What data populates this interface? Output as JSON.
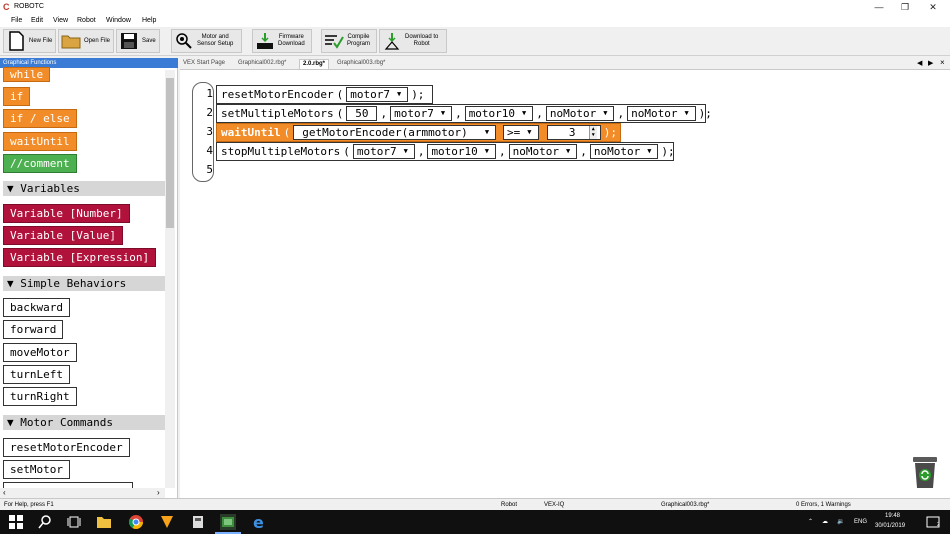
{
  "window": {
    "title": "ROBOTC"
  },
  "menu": [
    "File",
    "Edit",
    "View",
    "Robot",
    "Window",
    "Help"
  ],
  "toolbar": {
    "new_file": "New File",
    "open_file": "Open File",
    "save": "Save",
    "motor_sensor": "Motor and\nSensor Setup",
    "firmware": "Firmware\nDownload",
    "compile": "Compile\nProgram",
    "download": "Download to\nRobot"
  },
  "sidebar": {
    "header": "Graphical Functions",
    "flow_blocks": [
      "while",
      "if",
      "if / else",
      "waitUntil",
      "//comment"
    ],
    "sections": {
      "variables": "▼ Variables",
      "simple_behaviors": "▼ Simple Behaviors",
      "motor_commands": "▼ Motor Commands"
    },
    "variable_blocks": [
      "Variable [Number]",
      "Variable [Value]",
      "Variable [Expression]"
    ],
    "behavior_blocks": [
      "backward",
      "forward",
      "moveMotor",
      "turnLeft",
      "turnRight"
    ],
    "motor_blocks": [
      "resetMotorEncoder",
      "setMotor"
    ]
  },
  "tabs": [
    "VEX Start Page",
    "Graphical002.rbg*",
    "2.0.rbg*",
    "Graphical003.rbg*"
  ],
  "editor": {
    "line_numbers": [
      "1",
      "2",
      "3",
      "4",
      "5"
    ],
    "line1": {
      "fn": "resetMotorEncoder",
      "open": "(",
      "motor": "motor7",
      "close": ");"
    },
    "line2": {
      "fn": "setMultipleMotors",
      "open": "(",
      "speed": "50",
      "m1": "motor7",
      "m2": "motor10",
      "m3": "noMotor",
      "m4": "noMotor",
      "close": ");",
      "sep": ","
    },
    "line3": {
      "fn": "waitUntil",
      "open": "(",
      "cond": "getMotorEncoder(armmotor)",
      "op": ">=",
      "value": "3",
      "close": ");"
    },
    "line4": {
      "fn": "stopMultipleMotors",
      "open": "(",
      "m1": "motor7",
      "m2": "motor10",
      "m3": "noMotor",
      "m4": "noMotor",
      "close": ");",
      "sep": ","
    }
  },
  "status": {
    "help": "For Help, press F1",
    "target": "Robot",
    "platform": "VEX-IQ",
    "file": "Graphical003.rbg*",
    "errors": "0 Errors, 1 Warnings"
  },
  "taskbar": {
    "language": "ENG",
    "time": "19:48",
    "date": "30/01/2019",
    "notifications": "2"
  }
}
